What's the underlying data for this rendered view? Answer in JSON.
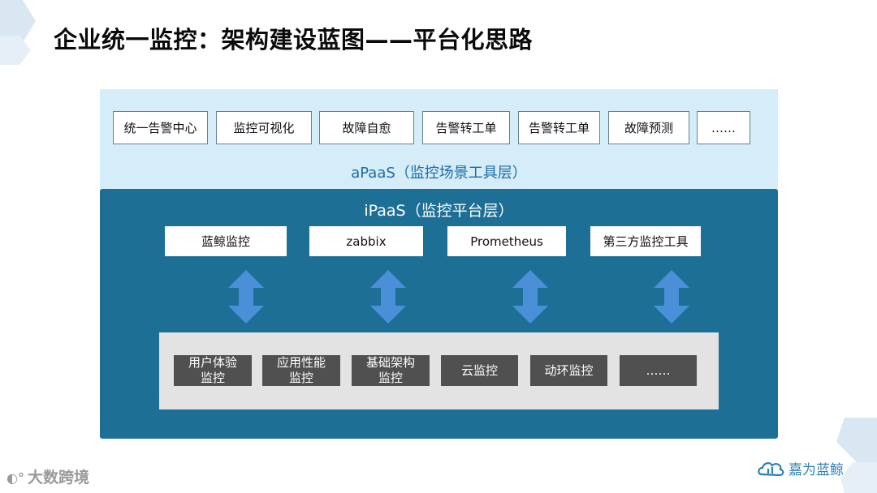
{
  "title": "企业统一监控：架构建设蓝图——平台化思路",
  "apaas": {
    "label": "aPaaS（监控场景工具层）",
    "items": [
      "统一告警中心",
      "监控可视化",
      "故障自愈",
      "告警转工单",
      "告警转工单",
      "故障预测",
      "……"
    ]
  },
  "ipaas": {
    "label": "iPaaS（监控平台层）",
    "tools": [
      "蓝鲸监控",
      "zabbix",
      "Prometheus",
      "第三方监控工具"
    ],
    "monitors": [
      "用户体验\n监控",
      "应用性能\n监控",
      "基础架构\n监控",
      "云监控",
      "动环监控",
      "……"
    ]
  },
  "footer": {
    "left_logo_text": "大数跨境",
    "right_logo_text": "嘉为蓝鲸"
  },
  "colors": {
    "apaas_bg": "#d4edf8",
    "ipaas_bg": "#1d6f96",
    "arrow": "#4a90d9",
    "monitor_box": "#505050",
    "bottom_panel": "#e3e3e3"
  }
}
